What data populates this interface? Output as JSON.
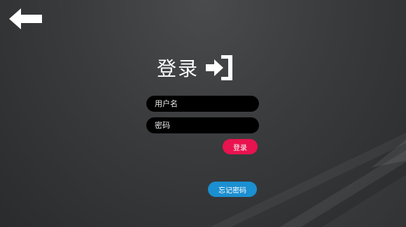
{
  "back": {
    "icon": "arrow-left-icon"
  },
  "header": {
    "title": "登录",
    "icon": "sign-in-icon"
  },
  "form": {
    "username_placeholder": "用户名",
    "password_placeholder": "密码"
  },
  "buttons": {
    "login_label": "登录",
    "forgot_label": "忘记密码"
  },
  "colors": {
    "login": "#e8134f",
    "forgot": "#1b8fd0",
    "field": "#000000"
  }
}
